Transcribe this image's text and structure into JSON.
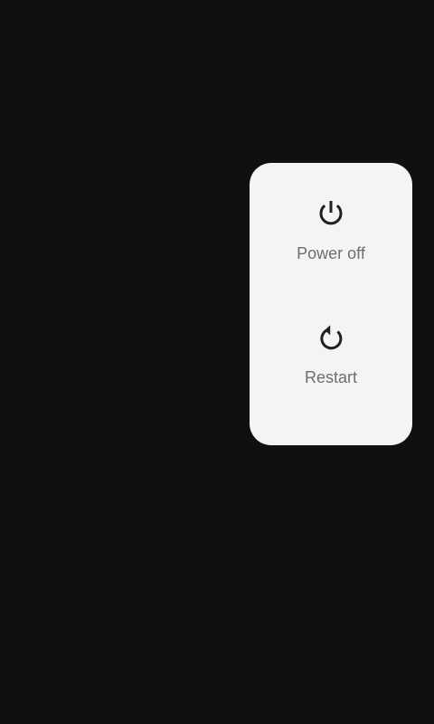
{
  "power_menu": {
    "actions": [
      {
        "label": "Power off",
        "icon": "power-icon"
      },
      {
        "label": "Restart",
        "icon": "restart-icon"
      }
    ]
  },
  "colors": {
    "background": "#101010",
    "menu_background": "#f4f4f4",
    "icon": "#202020",
    "label": "#6e6e6e"
  }
}
